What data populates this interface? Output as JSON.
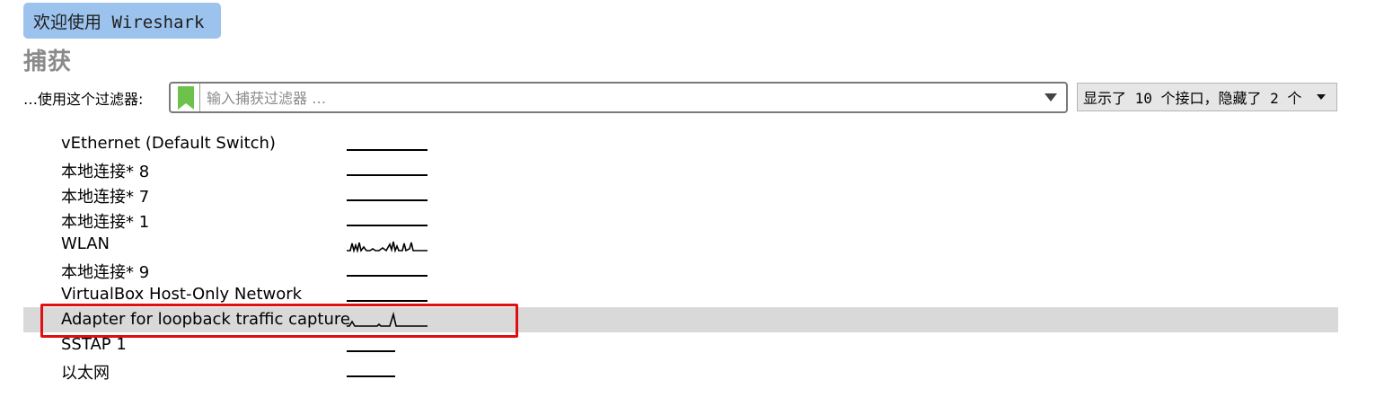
{
  "welcome": {
    "label": "欢迎使用 Wireshark"
  },
  "capture": {
    "heading": "捕获",
    "filter_label": "…使用这个过滤器:",
    "filter_placeholder": "输入捕获过滤器 …",
    "filter_value": "",
    "interface_select_label": "显示了 10 个接口，隐藏了 2 个"
  },
  "interfaces": [
    {
      "name": "vEthernet (Default Switch)",
      "traffic": "flat",
      "selected": false
    },
    {
      "name": "本地连接* 8",
      "traffic": "flat",
      "selected": false
    },
    {
      "name": "本地连接* 7",
      "traffic": "flat",
      "selected": false
    },
    {
      "name": "本地连接* 1",
      "traffic": "flat",
      "selected": false
    },
    {
      "name": "WLAN",
      "traffic": "active",
      "selected": false
    },
    {
      "name": "本地连接* 9",
      "traffic": "flat",
      "selected": false
    },
    {
      "name": "VirtualBox Host-Only Network",
      "traffic": "flat",
      "selected": false
    },
    {
      "name": "Adapter for loopback traffic capture",
      "traffic": "spikes",
      "selected": true
    },
    {
      "name": "SSTAP 1",
      "traffic": "flat",
      "selected": false
    },
    {
      "name": "以太网",
      "traffic": "flat",
      "selected": false
    }
  ],
  "colors": {
    "welcome_bg": "#9cc3ee",
    "bookmark": "#6cc24a",
    "selected_row": "#d9d9d9",
    "highlight": "#e01010"
  },
  "icons": {
    "bookmark": "bookmark-icon",
    "filter_dropdown": "chevron-down-icon",
    "interface_select": "caret-down-icon"
  }
}
